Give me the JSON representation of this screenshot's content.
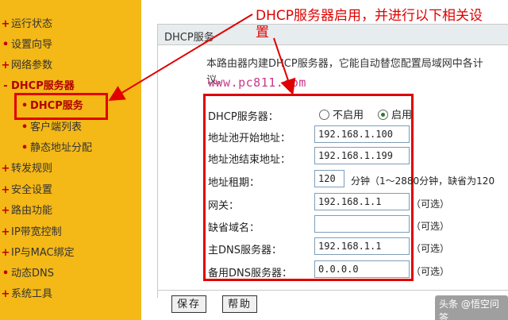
{
  "sidebar": {
    "items": [
      {
        "label": "运行状态",
        "bullet": "+"
      },
      {
        "label": "设置向导",
        "bullet": "•"
      },
      {
        "label": "网络参数",
        "bullet": "+"
      },
      {
        "label": "DHCP服务器",
        "bullet": "-"
      },
      {
        "label": "DHCP服务",
        "bullet": "•"
      },
      {
        "label": "客户端列表",
        "bullet": "•"
      },
      {
        "label": "静态地址分配",
        "bullet": "•"
      },
      {
        "label": "转发规则",
        "bullet": "+"
      },
      {
        "label": "安全设置",
        "bullet": "+"
      },
      {
        "label": "路由功能",
        "bullet": "+"
      },
      {
        "label": "IP带宽控制",
        "bullet": "+"
      },
      {
        "label": "IP与MAC绑定",
        "bullet": "+"
      },
      {
        "label": "动态DNS",
        "bullet": "•"
      },
      {
        "label": "系统工具",
        "bullet": "+"
      }
    ]
  },
  "header": {
    "title": "DHCP服务"
  },
  "description": {
    "line1": "本路由器内建DHCP服务器，它能自动替您配置局域网中各计",
    "line2": "议。"
  },
  "watermark_site": "www.pc811.com",
  "form": {
    "server": {
      "label": "DHCP服务器：",
      "off": "不启用",
      "on": "启用",
      "selected": "on"
    },
    "pool_start": {
      "label": "地址池开始地址：",
      "value": "192.168.1.100"
    },
    "pool_end": {
      "label": "地址池结束地址：",
      "value": "192.168.1.199"
    },
    "lease": {
      "label": "地址租期：",
      "value": "120",
      "hint": "分钟（1～2880分钟，缺省为120"
    },
    "gateway": {
      "label": "网关：",
      "value": "192.168.1.1",
      "hint": "（可选）"
    },
    "domain": {
      "label": "缺省域名：",
      "value": "",
      "hint": "（可选）"
    },
    "dns1": {
      "label": "主DNS服务器：",
      "value": "192.168.1.1",
      "hint": "（可选）"
    },
    "dns2": {
      "label": "备用DNS服务器：",
      "value": "0.0.0.0",
      "hint": "（可选）"
    }
  },
  "buttons": {
    "save": "保存",
    "help": "帮助"
  },
  "annotation": {
    "line1": "DHCP服务器启用，并进行以下相关设",
    "line2": "置"
  },
  "logo_text": "头条 @悟空问答",
  "colors": {
    "sidebar": "#f4b817",
    "highlight_red": "#e00000",
    "header_bar": "#e7ecef"
  }
}
